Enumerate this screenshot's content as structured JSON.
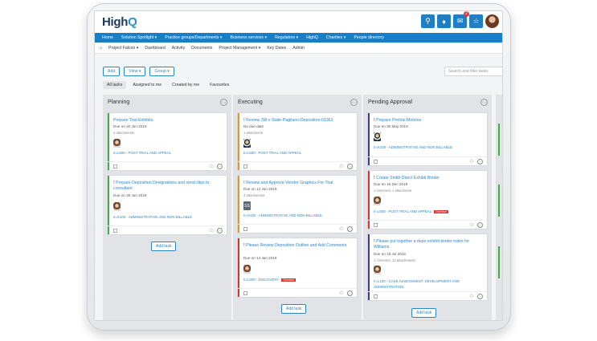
{
  "brand": {
    "logo_main": "High",
    "logo_accent": "Q"
  },
  "colors": {
    "accent": "#1b7ec4",
    "priority": "#d8332c",
    "overdue": "#d8332c",
    "bar_green": "#3fae49",
    "bar_orange": "#e8922a",
    "bar_red": "#d8332c",
    "bar_purple": "#3c3a8a"
  },
  "header_icons": [
    "search-icon",
    "bell-icon",
    "mail-icon",
    "star-icon"
  ],
  "mail_badge": "2",
  "main_nav": [
    "Home",
    "Solution Spotlight ▾",
    "Practice groups/Departments ▾",
    "Business services ▾",
    "Regulators ▾",
    "HighQ",
    "Charities ▾",
    "People directory"
  ],
  "sub_nav": [
    "Project Falcon ▾",
    "Dashboard",
    "Activity",
    "Documents",
    "Project Management ▾",
    "Key Dates",
    "Admin"
  ],
  "toolbar": {
    "add": "Add",
    "view": "View ▾",
    "group": "Group ▾"
  },
  "search": {
    "placeholder": "Search and filter tasks"
  },
  "filters": [
    "All tasks",
    "Assigned to me",
    "Created by me",
    "Favourites"
  ],
  "columns": [
    {
      "title": "Planning",
      "add_label": "Add task",
      "cards": [
        {
          "title": "Prepare Trial Exhibits",
          "priority": false,
          "due": "Due on 20 Jun 2019",
          "attachments": "4 attachments",
          "matter": "In L500 - POST TRIAL AND APPEAL",
          "overdue": ""
        },
        {
          "title": "Prepare Deposition Designations and send clips to consultant",
          "priority": true,
          "due": "Due on 25 Jun 2019",
          "attachments": "",
          "matter": "In K100 - ADMINISTRATIVE AND NON BILLABLE",
          "overdue": ""
        }
      ]
    },
    {
      "title": "Executing",
      "add_label": "Add task",
      "cards": [
        {
          "title": "Review JW-v-State-Pagliano-Deposition-01363",
          "priority": true,
          "due": "No due date",
          "attachments": "1 attachment",
          "matter": "In L500 - POST TRIAL AND APPEAL",
          "overdue": ""
        },
        {
          "title": "Review and Approve Vendor Graphics For Trial",
          "priority": true,
          "due": "Due on 12 Jun 2019",
          "attachments": "4 attachments",
          "avatar_initials": "SS",
          "matter": "In K100 - ADMINISTRATIVE AND NON BILLABLE",
          "overdue": ""
        },
        {
          "title": "Please Review Deposition Outline and Add Comments",
          "priority": true,
          "due": "Due on 14 Jan 2019",
          "attachments": "",
          "matter": "In L300 - DISCOVERY",
          "overdue": "Overdue"
        }
      ]
    },
    {
      "title": "Pending Approval",
      "add_label": "Add task",
      "cards": [
        {
          "title": "Prepare Pretrial Motions",
          "priority": true,
          "due": "Due on 30 May 2019",
          "attachments": "",
          "matter": "In K100 - ADMINISTRATIVE AND NON BILLABLE",
          "overdue": ""
        },
        {
          "title": "Create Smith Direct Exhibit Binder",
          "priority": true,
          "due": "Due on 16 Dec 2018",
          "attachments": "1 comment, 1 attachment",
          "matter": "In L500 - POST TRIAL AND APPEAL",
          "overdue": "Overdue"
        },
        {
          "title": "Please put together a depo exhibit binder index for Williams",
          "priority": true,
          "due": "Due on 18 Jul 2019",
          "attachments": "1 comment, 12 attachments",
          "matter": "In L100 - CASE ASSESSMENT, DEVELOPMENT AND ADMINISTRATION",
          "overdue": ""
        }
      ]
    }
  ]
}
